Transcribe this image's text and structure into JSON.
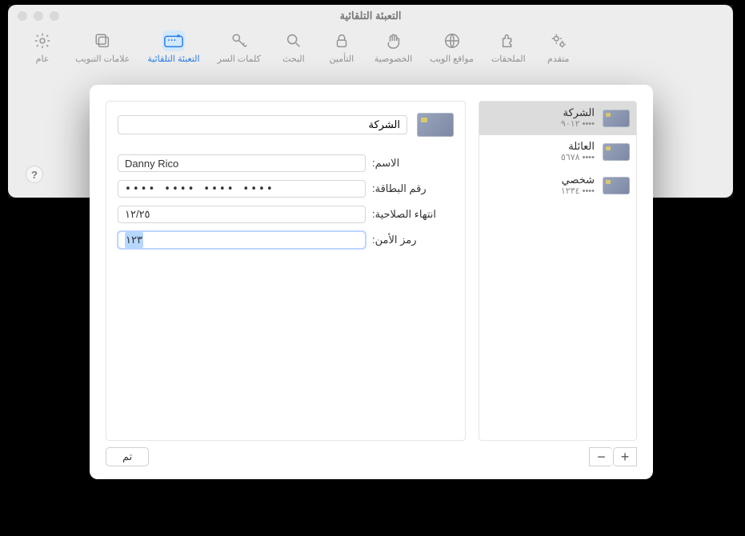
{
  "window": {
    "title": "التعبئة التلقائية"
  },
  "toolbar": {
    "items": [
      {
        "id": "general",
        "label": "عام"
      },
      {
        "id": "tabs",
        "label": "علامات التبويب"
      },
      {
        "id": "autofill",
        "label": "التعبئة التلقائية",
        "selected": true
      },
      {
        "id": "passwords",
        "label": "كلمات السر"
      },
      {
        "id": "search",
        "label": "البحث"
      },
      {
        "id": "security",
        "label": "التأمين"
      },
      {
        "id": "privacy",
        "label": "الخصوصية"
      },
      {
        "id": "websites",
        "label": "مواقع الويب"
      },
      {
        "id": "extensions",
        "label": "الملحقات"
      },
      {
        "id": "advanced",
        "label": "متقدم"
      }
    ]
  },
  "help": {
    "tooltip": "?"
  },
  "card_list": [
    {
      "name": "الشركة",
      "last4": "٩٠١٢",
      "selected": true,
      "dots": "••••"
    },
    {
      "name": "العائلة",
      "last4": "٥٦٧٨",
      "selected": false,
      "dots": "••••"
    },
    {
      "name": "شخصي",
      "last4": "١٢٣٤",
      "selected": false,
      "dots": "••••"
    }
  ],
  "detail": {
    "title_value": "الشركة",
    "fields": {
      "name_label": "الاسم:",
      "name_value": "Danny Rico",
      "number_label": "رقم البطاقة:",
      "number_value": "•••• •••• •••• ••••",
      "expiry_label": "انتهاء الصلاحية:",
      "expiry_value": "١٢/٢٥",
      "cvc_label": "رمز الأمن:",
      "cvc_value": "١٢٣"
    }
  },
  "buttons": {
    "add": "+",
    "remove": "−",
    "done": "تم"
  },
  "icons": {
    "general": "gear",
    "tabs": "tabs",
    "autofill": "autofill",
    "passwords": "key",
    "search": "magnify",
    "security": "lock",
    "privacy": "hand",
    "websites": "globe",
    "extensions": "puzzle",
    "advanced": "gears"
  }
}
